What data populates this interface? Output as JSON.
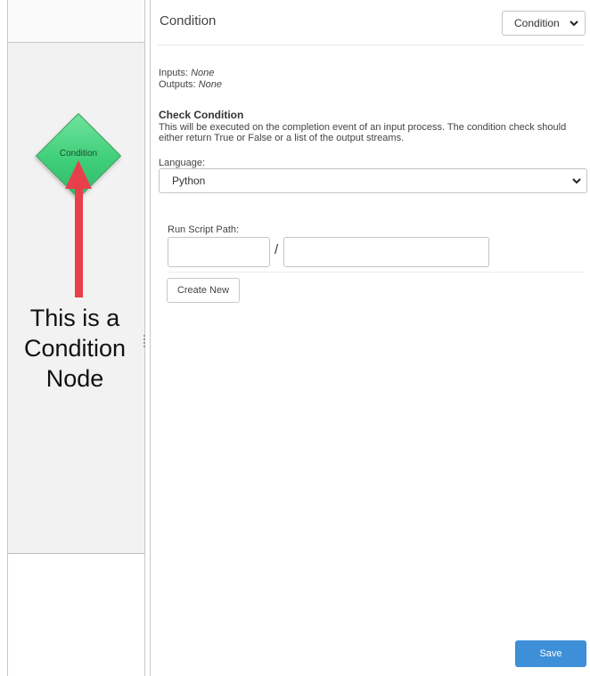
{
  "palette": {
    "node_label": "Condition",
    "annotation_lines": [
      "This is a",
      "Condition",
      "Node"
    ],
    "arrow_color": "#e8404a",
    "node_color": "#3fcf7a"
  },
  "panel": {
    "title": "Condition",
    "type_select_value": "Condition",
    "inputs_label": "Inputs:",
    "inputs_value": "None",
    "outputs_label": "Outputs:",
    "outputs_value": "None",
    "check_title": "Check Condition",
    "check_desc": "This will be executed on the completion event of an input process. The condition check should either return True or False or a list of the output streams.",
    "language_label": "Language:",
    "language_value": "Python",
    "run_script_label": "Run Script Path:",
    "path_separator": "/",
    "create_new_label": "Create New",
    "save_label": "Save",
    "save_color": "#3d8fd8"
  }
}
